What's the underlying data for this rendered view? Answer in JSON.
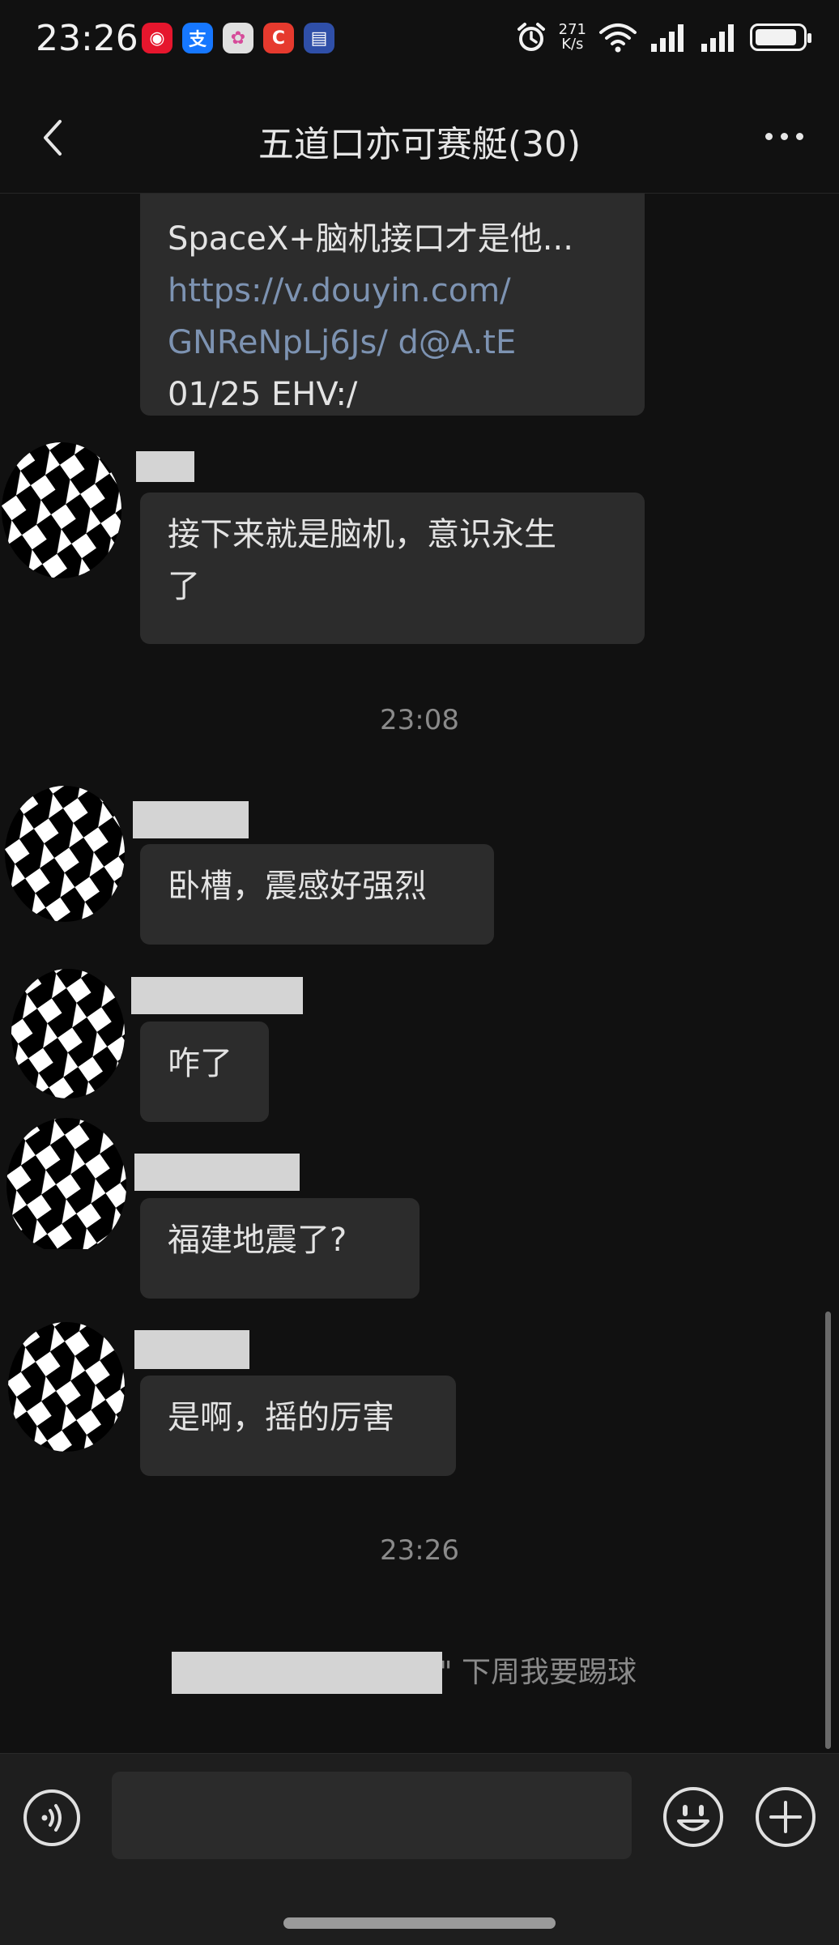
{
  "status_bar": {
    "time": "23:26",
    "net_speed_value": "271",
    "net_speed_unit": "K/s",
    "app_icons": [
      {
        "name": "weibo-icon",
        "glyph": "◉",
        "bg": "#e6162d"
      },
      {
        "name": "alipay-icon",
        "glyph": "支",
        "bg": "#1677ff"
      },
      {
        "name": "photos-icon",
        "glyph": "✿",
        "bg": "#e0e0e0"
      },
      {
        "name": "c-app-icon",
        "glyph": "C",
        "bg": "#e63a2e"
      },
      {
        "name": "card-app-icon",
        "glyph": "▤",
        "bg": "#2f4fa8"
      }
    ]
  },
  "header": {
    "title": "五道口亦可赛艇(30)"
  },
  "messages": {
    "m0": {
      "line1": "SpaceX+脑机接口才是他...",
      "link1": "https://v.douyin.com/",
      "link2": "GNReNpLj6Js/ d@A.tE",
      "line4": "01/25 EHV:/"
    },
    "m1": {
      "text1": "接下来就是脑机，意识永生",
      "text2": "了"
    },
    "ts1": "23:08",
    "m2": "卧槽，震感好强烈",
    "m3": "咋了",
    "m4": "福建地震了?",
    "m5": "是啊，摇的厉害",
    "ts2": "23:26",
    "system": "\" 下周我要踢球"
  },
  "input": {
    "placeholder": ""
  },
  "colors": {
    "background": "#111111",
    "bubble": "#2c2c2c",
    "link": "#7d93b2",
    "input_bar": "#1e1e1e"
  }
}
